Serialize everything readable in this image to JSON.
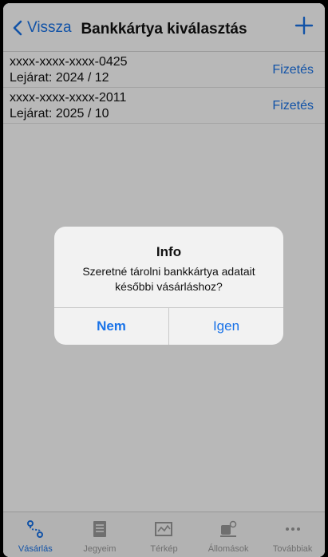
{
  "navbar": {
    "back_label": "Vissza",
    "title": "Bankkártya kiválasztás",
    "add_icon": "plus-icon"
  },
  "cards": [
    {
      "number": "xxxx-xxxx-xxxx-0425",
      "expiry": "Lejárat: 2024 / 12",
      "action": "Fizetés"
    },
    {
      "number": "xxxx-xxxx-xxxx-2011",
      "expiry": "Lejárat: 2025 / 10",
      "action": "Fizetés"
    }
  ],
  "dialog": {
    "title": "Info",
    "message": "Szeretné tárolni bankkártya adatait későbbi vásárláshoz?",
    "no_label": "Nem",
    "yes_label": "Igen"
  },
  "tabbar": {
    "items": [
      {
        "label": "Vásárlás",
        "icon": "route-icon",
        "active": true
      },
      {
        "label": "Jegyeim",
        "icon": "ticket-icon",
        "active": false
      },
      {
        "label": "Térkép",
        "icon": "map-icon",
        "active": false
      },
      {
        "label": "Állomások",
        "icon": "station-icon",
        "active": false
      },
      {
        "label": "Továbbiak",
        "icon": "more-icon",
        "active": false
      }
    ]
  },
  "colors": {
    "accent": "#1a73e8",
    "inactive": "#9a9a9a"
  }
}
